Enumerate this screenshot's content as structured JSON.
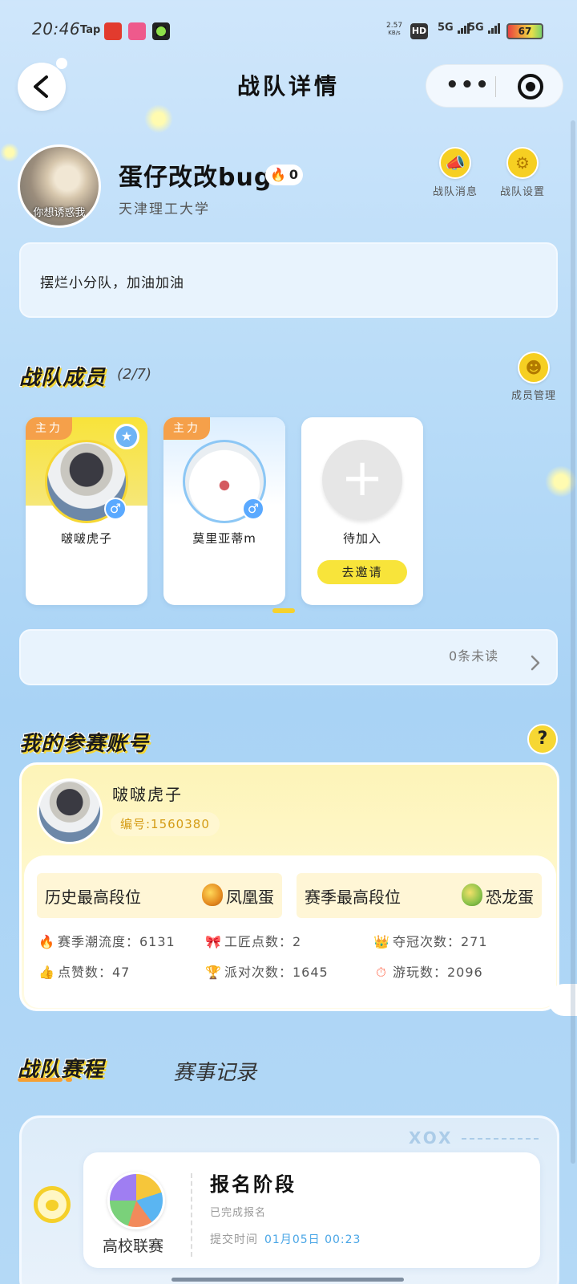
{
  "status_bar": {
    "time": "20:46",
    "app_tap": "Tap",
    "speed": "2.57",
    "speed_unit": "KB/s",
    "hd": "HD",
    "net1": "5G",
    "net2": "5G",
    "battery": "67"
  },
  "nav": {
    "title": "战队详情",
    "more": "•••"
  },
  "team": {
    "avatar_caption": "你想诱惑我",
    "name": "蛋仔改改bug",
    "heat": "0",
    "school": "天津理工大学",
    "messages_label": "战队消息",
    "settings_label": "战队设置",
    "motto": "摆烂小分队，加油加油"
  },
  "members": {
    "title": "战队成员",
    "count": "(2/7)",
    "manage_label": "成员管理",
    "list": [
      {
        "tag": "主力",
        "name": "啵啵虎子"
      },
      {
        "tag": "主力",
        "name": "莫里亚蒂m"
      },
      {
        "name": "待加入",
        "action": "去邀请"
      }
    ],
    "unread": "0条未读"
  },
  "account": {
    "title": "我的参赛账号",
    "help": "?",
    "name": "啵啵虎子",
    "id": "编号:1560380",
    "history_rank_label": "历史最高段位",
    "history_rank_value": "凤凰蛋",
    "season_rank_label": "赛季最高段位",
    "season_rank_value": "恐龙蛋",
    "stats": [
      {
        "label": "赛季潮流度：6131"
      },
      {
        "label": "工匠点数：2"
      },
      {
        "label": "夺冠次数：271"
      },
      {
        "label": "点赞数：47"
      },
      {
        "label": "派对次数：1645"
      },
      {
        "label": "游玩数：2096"
      }
    ]
  },
  "tabs": {
    "active": "战队赛程",
    "other": "赛事记录"
  },
  "schedule": {
    "league": "高校联赛",
    "stage": "报名阶段",
    "stage_sub": "已完成报名",
    "submit_label": "提交时间",
    "submit_time": "01月05日 00:23"
  },
  "colors": {
    "accent_yellow": "#f6d733",
    "tag_orange": "#f5a04a",
    "link_blue": "#4aa6e6",
    "bg_blue": "#b9dcf8"
  }
}
